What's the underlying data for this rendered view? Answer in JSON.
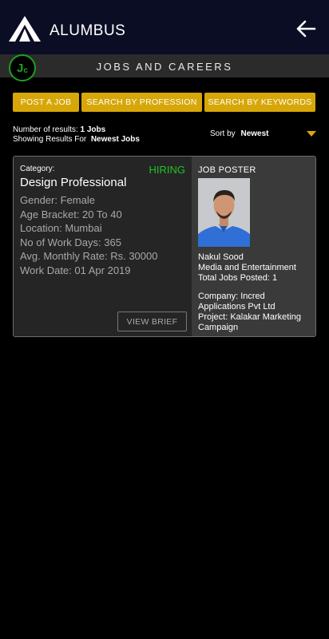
{
  "header": {
    "title": "ALUMBUS"
  },
  "subheader": {
    "badge_main": "J",
    "badge_sub": "c",
    "title": "JOBS AND CAREERS"
  },
  "actions": {
    "post_job": "POST A JOB",
    "search_profession": "SEARCH BY PROFESSION",
    "search_keywords": "SEARCH BY KEYWORDS"
  },
  "results": {
    "count_label": "Number of results:",
    "count_value": "1 Jobs",
    "showing_label": "Showing Results For",
    "showing_value": "Newest Jobs",
    "sort_label": "Sort by",
    "sort_value": "Newest"
  },
  "job": {
    "category_label": "Category:",
    "status": "HIRING",
    "title": "Design Professional",
    "gender": "Gender: Female",
    "age": "Age Bracket: 20 To 40",
    "location": "Location: Mumbai",
    "work_days": "No of Work Days: 365",
    "rate": "Avg. Monthly Rate: Rs. 30000",
    "work_date": "Work Date: 01 Apr 2019",
    "view_brief": "VIEW BRIEF",
    "poster_label": "JOB POSTER",
    "poster_name": "Nakul Sood",
    "poster_industry": "Media and Entertainment",
    "poster_jobs": "Total Jobs Posted: 1",
    "company": "Company: Incred Applications Pvt Ltd",
    "project": "Project: Kalakar Marketing Campaign"
  },
  "colors": {
    "accent": "#d7a70a",
    "status_green": "#22c222",
    "header_bg": "#0b0d24"
  },
  "icons": {
    "logo": "alumbus-logo",
    "back": "back-arrow-icon",
    "sort": "dropdown-triangle-icon"
  }
}
